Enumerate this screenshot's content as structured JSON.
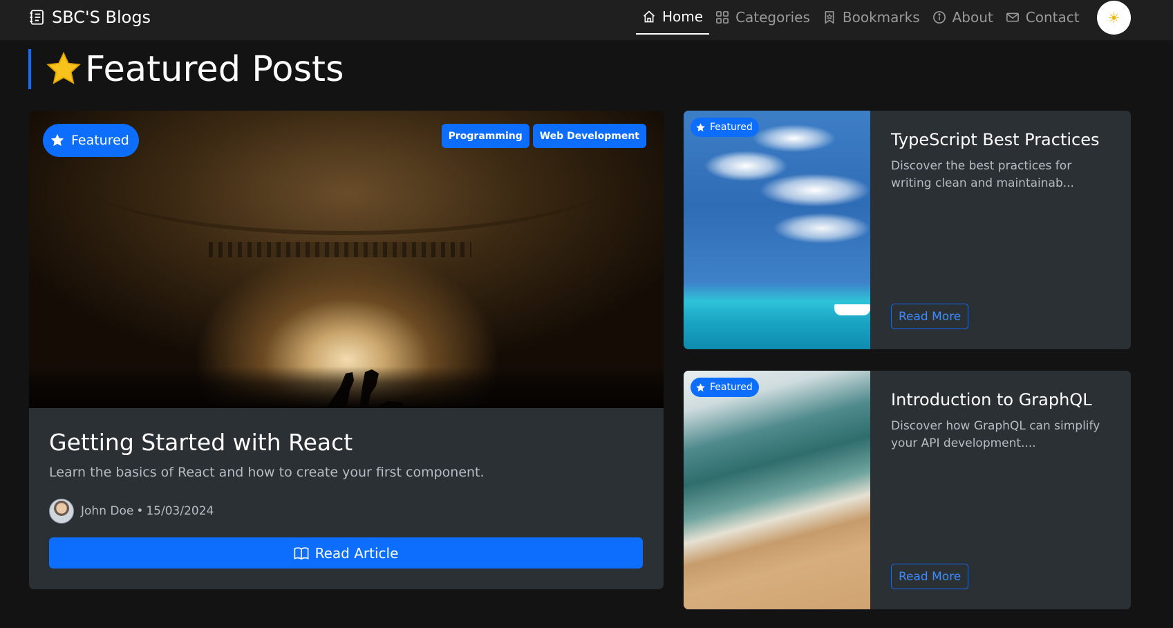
{
  "navbar": {
    "brand": "SBC'S Blogs",
    "brand_icon": "journal-text-icon",
    "items": [
      {
        "label": "Home",
        "icon": "house-icon",
        "active": true
      },
      {
        "label": "Categories",
        "icon": "grid-icon",
        "active": false
      },
      {
        "label": "Bookmarks",
        "icon": "bookmark-icon",
        "active": false
      },
      {
        "label": "About",
        "icon": "info-circle-icon",
        "active": false
      },
      {
        "label": "Contact",
        "icon": "envelope-icon",
        "active": false
      }
    ],
    "theme_toggle_icon": "sun-icon",
    "theme_toggle_glyph": "☀"
  },
  "section": {
    "title": "Featured Posts",
    "icon": "star-icon"
  },
  "main_post": {
    "badge": "Featured",
    "tags": [
      "Programming",
      "Web Development"
    ],
    "title": "Getting Started with React",
    "excerpt": "Learn the basics of React and how to create your first component.",
    "author": "John Doe",
    "separator": "•",
    "date": "15/03/2024",
    "button": "Read Article",
    "button_icon": "book-icon",
    "image": "concert-crowd-photo"
  },
  "side_posts": [
    {
      "badge": "Featured",
      "title": "TypeScript Best Practices",
      "excerpt": "Discover the best practices for writing clean and maintainab...",
      "button": "Read More",
      "image": "sky-ocean-boat-photo"
    },
    {
      "badge": "Featured",
      "title": "Introduction to GraphQL",
      "excerpt": "Discover how GraphQL can simplify your API development....",
      "button": "Read More",
      "image": "beach-waves-photo"
    }
  ],
  "colors": {
    "background": "#131313",
    "navbar": "#1f1f1f",
    "card": "#2b3035",
    "accent": "#0d6efd",
    "muted_text": "#b7bcc2",
    "nav_inactive": "#9a9a9a"
  }
}
